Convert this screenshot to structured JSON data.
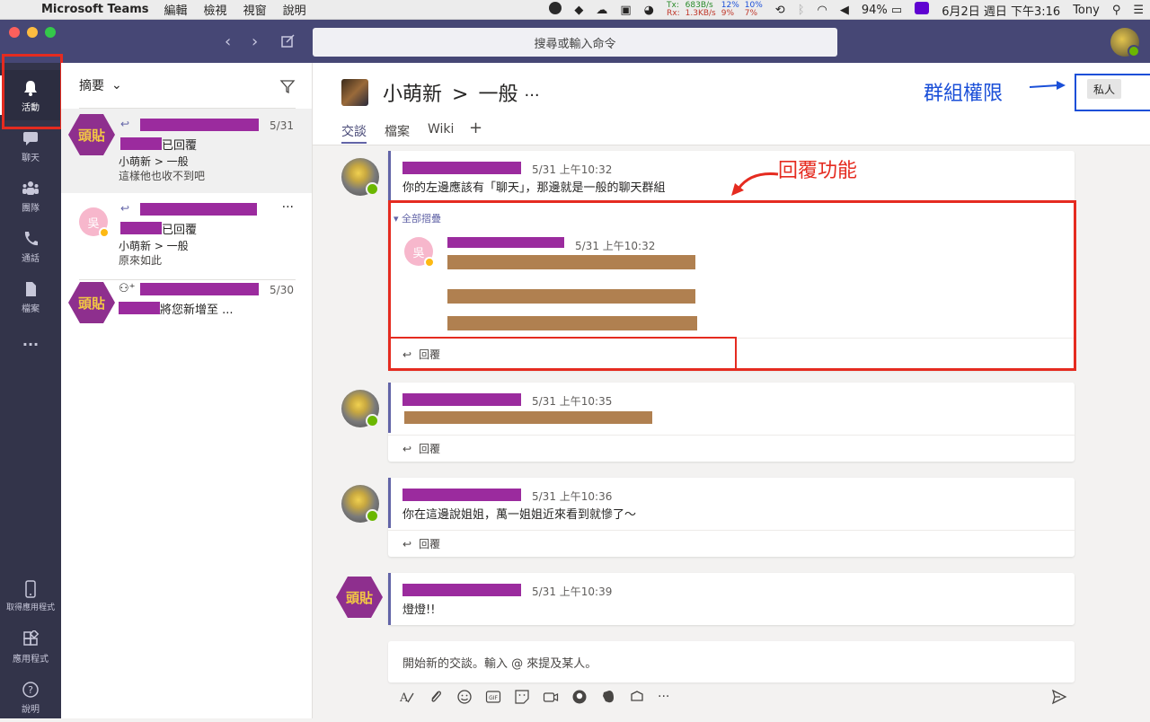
{
  "menubar": {
    "app_name": "Microsoft Teams",
    "menus": [
      "編輯",
      "檢視",
      "視窗",
      "說明"
    ],
    "net_tx_label": "Tx:",
    "net_rx_label": "Rx:",
    "net_tx": "683B/s",
    "net_rx": "1.3KB/s",
    "cpu1_top": "12%",
    "cpu1_bottom": "9%",
    "cpu2_top": "10%",
    "cpu2_bottom": "7%",
    "battery": "94%",
    "datetime": "6月2日 週日 下午3:16",
    "user": "Tony"
  },
  "topbar": {
    "search_placeholder": "搜尋或輸入命令"
  },
  "rail": {
    "activity": "活動",
    "chat": "聊天",
    "teams": "團隊",
    "calls": "通話",
    "files": "檔案",
    "more": "...",
    "get_app": "取得應用程式",
    "apps": "應用程式",
    "help": "說明"
  },
  "feed": {
    "header": "摘要",
    "items": [
      {
        "avatar": "頭貼",
        "action": "已回覆",
        "line2": "小萌新 > 一般",
        "line3": "這樣他也收不到吧",
        "date": "5/31"
      },
      {
        "avatar": "吳",
        "action": "已回覆",
        "line2": "小萌新 > 一般",
        "line3": "原來如此",
        "date": ""
      },
      {
        "avatar": "頭貼",
        "action": "將您新增至 ...",
        "date": "5/30"
      }
    ]
  },
  "channel": {
    "team": "小萌新",
    "separator": ">",
    "channel": "一般",
    "more": "···",
    "tabs": [
      "交談",
      "檔案",
      "Wiki",
      "+"
    ],
    "private_badge": "私人",
    "perm_annotation": "群組權限",
    "reply_annotation": "回覆功能",
    "messages": [
      {
        "time": "5/31 上午10:32",
        "body": "你的左邊應該有「聊天」，那邊就是一般的聊天群組",
        "collapse": "全部摺疊",
        "reply_avatar": "吳",
        "reply_time": "5/31 上午10:32",
        "reply_label": "回覆"
      },
      {
        "time": "5/31 上午10:35",
        "reply_label": "回覆"
      },
      {
        "time": "5/31 上午10:36",
        "body": "你在這邊說姐姐，萬一姐姐近來看到就慘了～",
        "reply_label": "回覆"
      },
      {
        "time": "5/31 上午10:39",
        "body": "燈燈!!",
        "avatar": "頭貼"
      }
    ],
    "compose_placeholder": "開始新的交談。輸入 @ 來提及某人。"
  }
}
